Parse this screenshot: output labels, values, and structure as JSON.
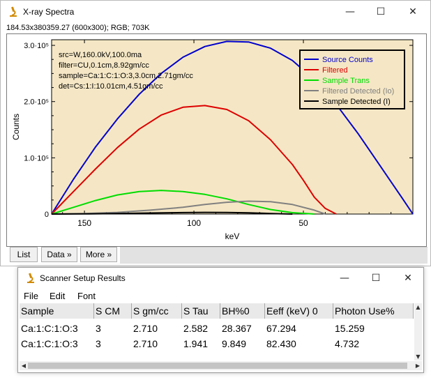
{
  "plot_window": {
    "title": "X-ray Spectra",
    "info": "184.53x380359.27   (600x300); RGB; 703K",
    "buttons": {
      "list": "List",
      "data": "Data »",
      "more": "More »"
    },
    "controls": {
      "minimize": "—",
      "maximize": "☐",
      "close": "✕"
    }
  },
  "chart_data": {
    "type": "line",
    "xlabel": "keV",
    "ylabel": "Counts",
    "xlim": [
      165,
      0
    ],
    "ylim": [
      0,
      310000
    ],
    "x_reversed": true,
    "x_ticks": [
      150,
      100,
      50
    ],
    "x_tick_labels": [
      "150",
      "100",
      "50"
    ],
    "y_ticks": [
      0,
      100000,
      200000,
      300000
    ],
    "y_tick_labels": [
      "0",
      "1.0·10⁵",
      "2.0·10⁵",
      "3.0·10⁵"
    ],
    "plot_bg": "#f5e7c5",
    "annotations": [
      "src=W,160.0kV,100.0ma",
      "filter=CU,0.1cm,8.92gm/cc",
      "sample=Ca:1:C:1:O:3,3.0cm,2.71gm/cc",
      "det=Cs:1:I:10.01cm,4.51gm/cc"
    ],
    "legend_position": "top-right",
    "series": [
      {
        "name": "Source Counts",
        "color": "#0000cc",
        "x": [
          165,
          155,
          145,
          135,
          125,
          115,
          105,
          95,
          85,
          75,
          65,
          55,
          45,
          35,
          25,
          15,
          5,
          0
        ],
        "y": [
          0,
          62000,
          119000,
          169000,
          213000,
          250000,
          279000,
          298000,
          307000,
          306000,
          295000,
          273000,
          239000,
          195000,
          143000,
          86000,
          29000,
          0
        ]
      },
      {
        "name": "Filtered",
        "color": "#dd0000",
        "x": [
          165,
          155,
          145,
          135,
          125,
          115,
          105,
          95,
          85,
          75,
          65,
          55,
          50,
          45,
          40,
          35
        ],
        "y": [
          0,
          40000,
          80000,
          118000,
          151000,
          176000,
          190000,
          193000,
          186000,
          166000,
          132000,
          88000,
          60000,
          30000,
          10000,
          0
        ]
      },
      {
        "name": "Sample Trans",
        "color": "#00dd00",
        "x": [
          165,
          155,
          145,
          135,
          125,
          115,
          105,
          95,
          85,
          75,
          65,
          55,
          45
        ],
        "y": [
          0,
          12000,
          24000,
          34000,
          40000,
          42000,
          40000,
          35000,
          27000,
          17000,
          8000,
          2500,
          0
        ]
      },
      {
        "name": "Filtered Detected (Io)",
        "color": "#808080",
        "x": [
          165,
          150,
          135,
          120,
          105,
          95,
          85,
          75,
          65,
          55,
          45,
          40
        ],
        "y": [
          0,
          1000,
          3000,
          7000,
          12000,
          17000,
          21000,
          23000,
          22000,
          17000,
          7000,
          0
        ]
      },
      {
        "name": "Sample Detected (I)",
        "color": "#000000",
        "x": [
          165,
          150,
          135,
          120,
          105,
          95,
          85,
          75,
          65,
          55
        ],
        "y": [
          0,
          300,
          900,
          1800,
          2600,
          3000,
          2900,
          2200,
          1000,
          0
        ]
      }
    ]
  },
  "results_window": {
    "title": "Scanner Setup Results",
    "menu": [
      "File",
      "Edit",
      "Font"
    ],
    "controls": {
      "minimize": "—",
      "maximize": "☐",
      "close": "✕"
    },
    "columns": [
      "Sample",
      "S CM",
      "S gm/cc",
      "S Tau",
      "BH%0",
      "Eeff (keV) 0",
      "Photon Use%"
    ],
    "rows": [
      [
        "Ca:1:C:1:O:3",
        "3",
        "2.710",
        "2.582",
        "28.367",
        "67.294",
        "15.259"
      ],
      [
        "Ca:1:C:1:O:3",
        "3",
        "2.710",
        "1.941",
        "9.849",
        "82.430",
        "4.732"
      ]
    ]
  }
}
